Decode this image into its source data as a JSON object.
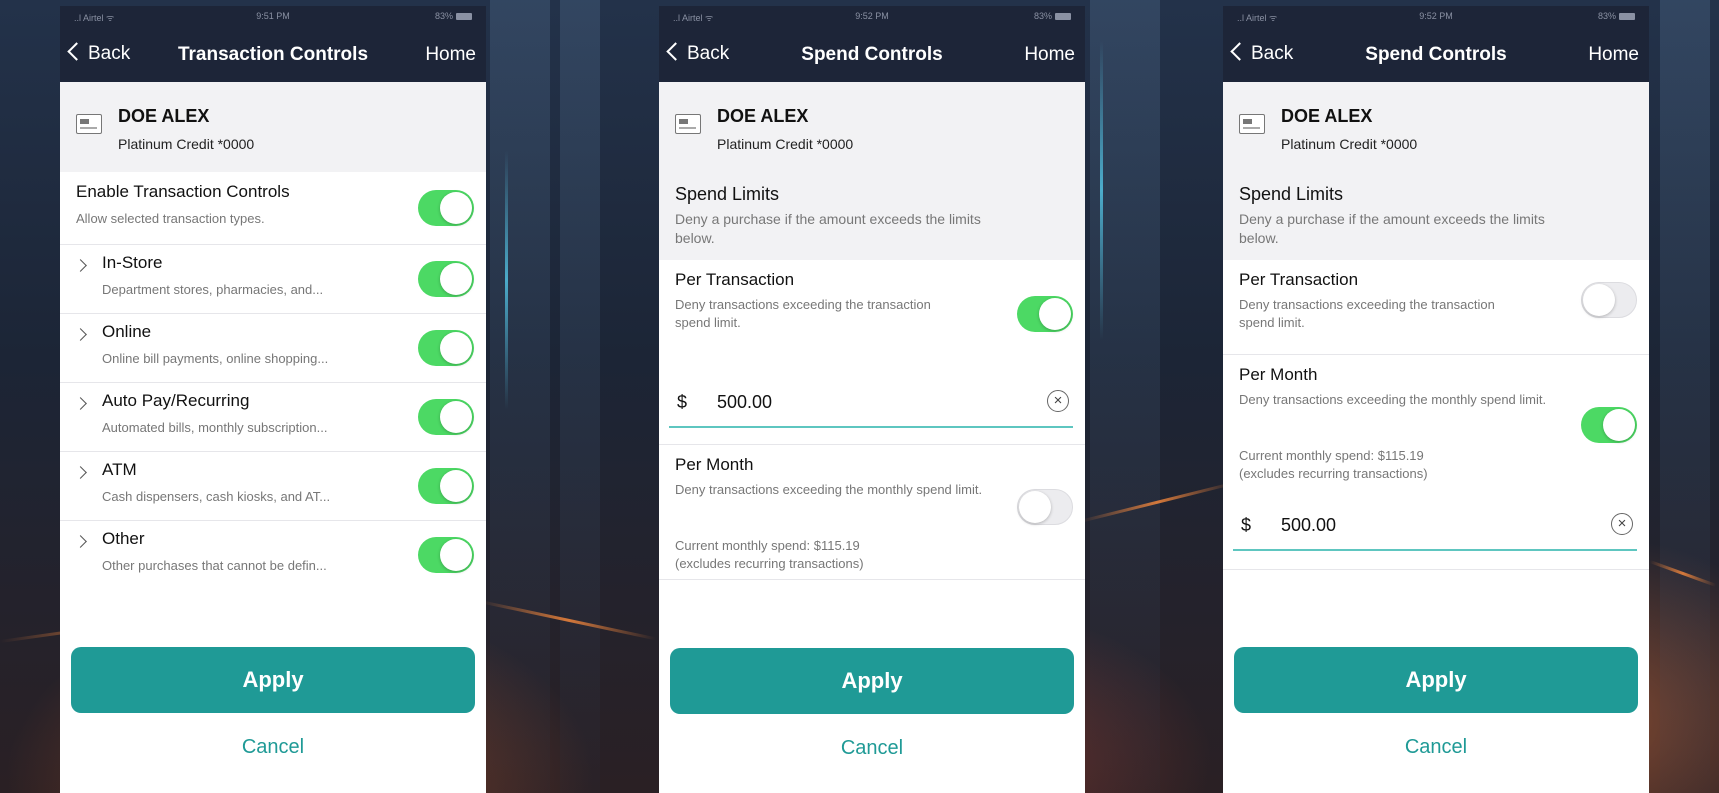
{
  "status_bar": {
    "carrier": "..l Airtel ᯤ",
    "battery": "83%"
  },
  "screens": [
    {
      "time": "9:51 PM",
      "nav": {
        "back": "Back",
        "title": "Transaction Controls",
        "home": "Home"
      },
      "card": {
        "name": "DOE ALEX",
        "number": "Platinum Credit *0000"
      },
      "enable": {
        "title": "Enable Transaction Controls",
        "desc": "Allow selected transaction types.",
        "on": true
      },
      "items": [
        {
          "title": "In-Store",
          "desc": "Department stores, pharmacies, and...",
          "on": true
        },
        {
          "title": "Online",
          "desc": "Online bill payments, online shopping...",
          "on": true
        },
        {
          "title": "Auto Pay/Recurring",
          "desc": "Automated bills, monthly subscription...",
          "on": true
        },
        {
          "title": "ATM",
          "desc": "Cash dispensers, cash kiosks, and AT...",
          "on": true
        },
        {
          "title": "Other",
          "desc": "Other purchases that cannot be defin...",
          "on": true
        }
      ],
      "apply": "Apply",
      "cancel": "Cancel"
    },
    {
      "time": "9:52 PM",
      "nav": {
        "back": "Back",
        "title": "Spend Controls",
        "home": "Home"
      },
      "card": {
        "name": "DOE ALEX",
        "number": "Platinum Credit *0000"
      },
      "limits": {
        "title": "Spend Limits",
        "desc": "Deny a purchase if the amount exceeds the limits below."
      },
      "per_transaction": {
        "title": "Per Transaction",
        "desc": "Deny transactions exceeding the transaction spend limit.",
        "on": true,
        "currency": "$",
        "amount": "500.00"
      },
      "per_month": {
        "title": "Per Month",
        "desc": "Deny transactions exceeding the monthly spend limit.",
        "on": false,
        "current": "Current monthly spend: $115.19",
        "note": "(excludes recurring transactions)"
      },
      "apply": "Apply",
      "cancel": "Cancel"
    },
    {
      "time": "9:52 PM",
      "nav": {
        "back": "Back",
        "title": "Spend Controls",
        "home": "Home"
      },
      "card": {
        "name": "DOE ALEX",
        "number": "Platinum Credit *0000"
      },
      "limits": {
        "title": "Spend Limits",
        "desc": "Deny a purchase if the amount exceeds the limits below."
      },
      "per_transaction": {
        "title": "Per Transaction",
        "desc": "Deny transactions exceeding the transaction spend limit.",
        "on": false
      },
      "per_month": {
        "title": "Per Month",
        "desc": "Deny transactions exceeding the monthly spend limit.",
        "on": true,
        "current": "Current monthly spend: $115.19",
        "note": "(excludes recurring transactions)",
        "currency": "$",
        "amount": "500.00"
      },
      "apply": "Apply",
      "cancel": "Cancel"
    }
  ],
  "colors": {
    "nav_bg": "#1d2538",
    "accent": "#1f9a96",
    "toggle_on": "#4cd964",
    "underline": "#5ec6c0"
  }
}
